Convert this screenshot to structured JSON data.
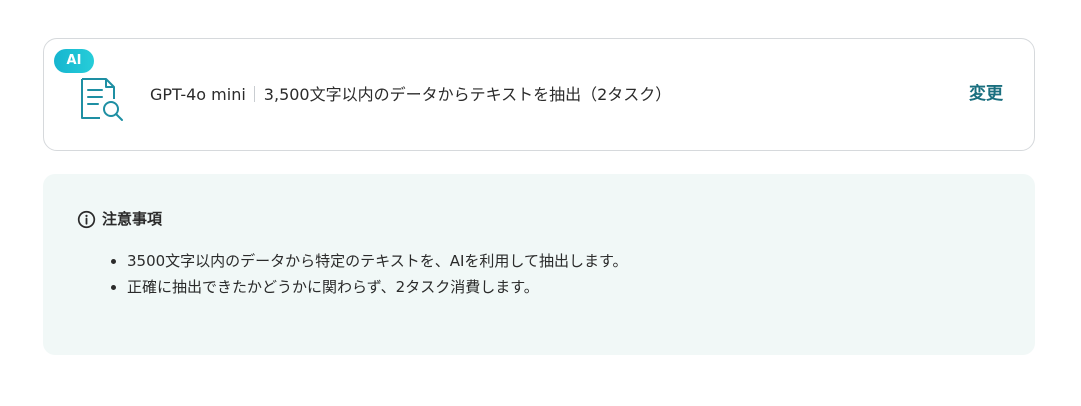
{
  "model_card": {
    "badge": "AI",
    "icon": "document-search-icon",
    "model_name": "GPT-4o mini",
    "description": "3,500文字以内のデータからテキストを抽出（2タスク）",
    "change_label": "変更"
  },
  "notice": {
    "icon": "info-icon",
    "title": "注意事項",
    "items": [
      "3500文字以内のデータから特定のテキストを、AIを利用して抽出します。",
      "正確に抽出できたかどうかに関わらず、2タスク消費します。"
    ]
  },
  "colors": {
    "accent_link": "#1a6f7f",
    "badge_gradient_start": "#16b5cf",
    "badge_gradient_end": "#26cdd9",
    "icon_teal": "#1e8fa3",
    "notice_background": "#f1f8f7",
    "card_border": "#d6d9dc"
  }
}
